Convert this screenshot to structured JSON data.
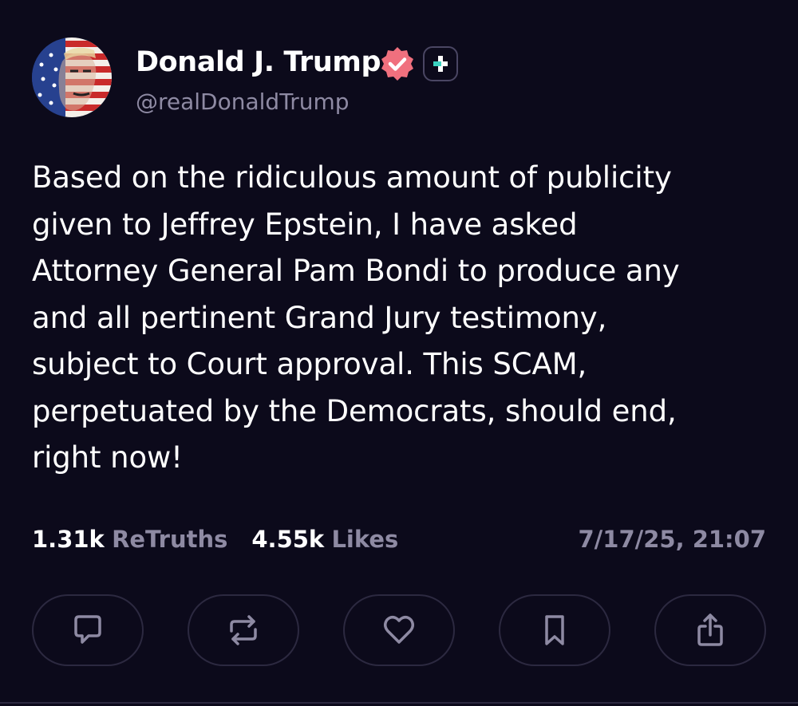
{
  "author": {
    "display_name": "Donald J. Trump",
    "handle": "@realDonaldTrump",
    "verified_icon": "verified-badge-icon",
    "verified_color": "#f0707e",
    "plus_icon": "plus-badge-icon"
  },
  "post": {
    "text": "Based on the ridiculous amount of publicity\ngiven to Jeffrey Epstein, I have asked\nAttorney General Pam Bondi to produce any\nand all pertinent Grand Jury testimony,\nsubject to Court approval. This SCAM,\nperpetuated by the Democrats, should end,\nright now!"
  },
  "stats": {
    "retruths_count": "1.31k",
    "retruths_label": "ReTruths",
    "likes_count": "4.55k",
    "likes_label": "Likes",
    "timestamp": "7/17/25, 21:07"
  },
  "actions": [
    {
      "name": "reply",
      "icon": "comment-icon"
    },
    {
      "name": "retruth",
      "icon": "repost-icon"
    },
    {
      "name": "like",
      "icon": "heart-icon"
    },
    {
      "name": "bookmark",
      "icon": "bookmark-icon"
    },
    {
      "name": "share",
      "icon": "share-icon"
    }
  ],
  "colors": {
    "background": "#0c0a1b",
    "text_primary": "#ffffff",
    "text_secondary": "#8e8aa3",
    "border": "#2c2940",
    "accent_teal": "#3ad2c0"
  }
}
